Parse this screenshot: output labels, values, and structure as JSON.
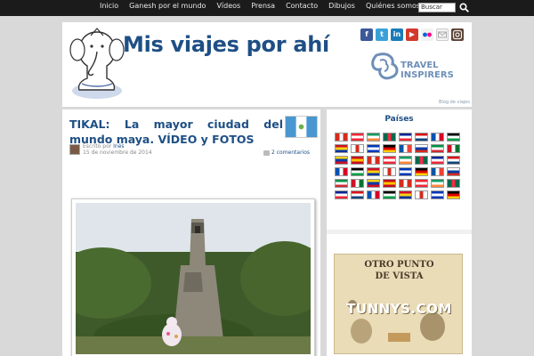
{
  "nav": {
    "items": [
      "Inicio",
      "Ganesh por el mundo",
      "Vídeos",
      "Prensa",
      "Contacto",
      "Dibujos",
      "Quiénes somos"
    ],
    "search_placeholder": "Buscar"
  },
  "header": {
    "title": "Mis viajes por ahí",
    "tagline": "Blog de viajes",
    "partner_line1": "TRAVEL",
    "partner_line2": "INSPIRERS",
    "social_icons": [
      "facebook-icon",
      "twitter-icon",
      "linkedin-icon",
      "youtube-icon",
      "flickr-icon",
      "email-icon",
      "instagram-icon"
    ]
  },
  "post": {
    "title": "TIKAL: La mayor ciudad del mundo maya. VÍDEO y FOTOS",
    "posted_by_prefix": "Escrito por",
    "author": "Inés",
    "date": "15 de noviembre de 2014",
    "comments": "2 comentarios"
  },
  "sidebar": {
    "countries_title": "Países",
    "ad_line1": "OTRO PUNTO",
    "ad_line2": "DE VISTA",
    "ad_brand": "TUNNYS.COM"
  },
  "colors": {
    "brand_blue": "#1e4f85",
    "nav_background": "#1b1b1b"
  }
}
